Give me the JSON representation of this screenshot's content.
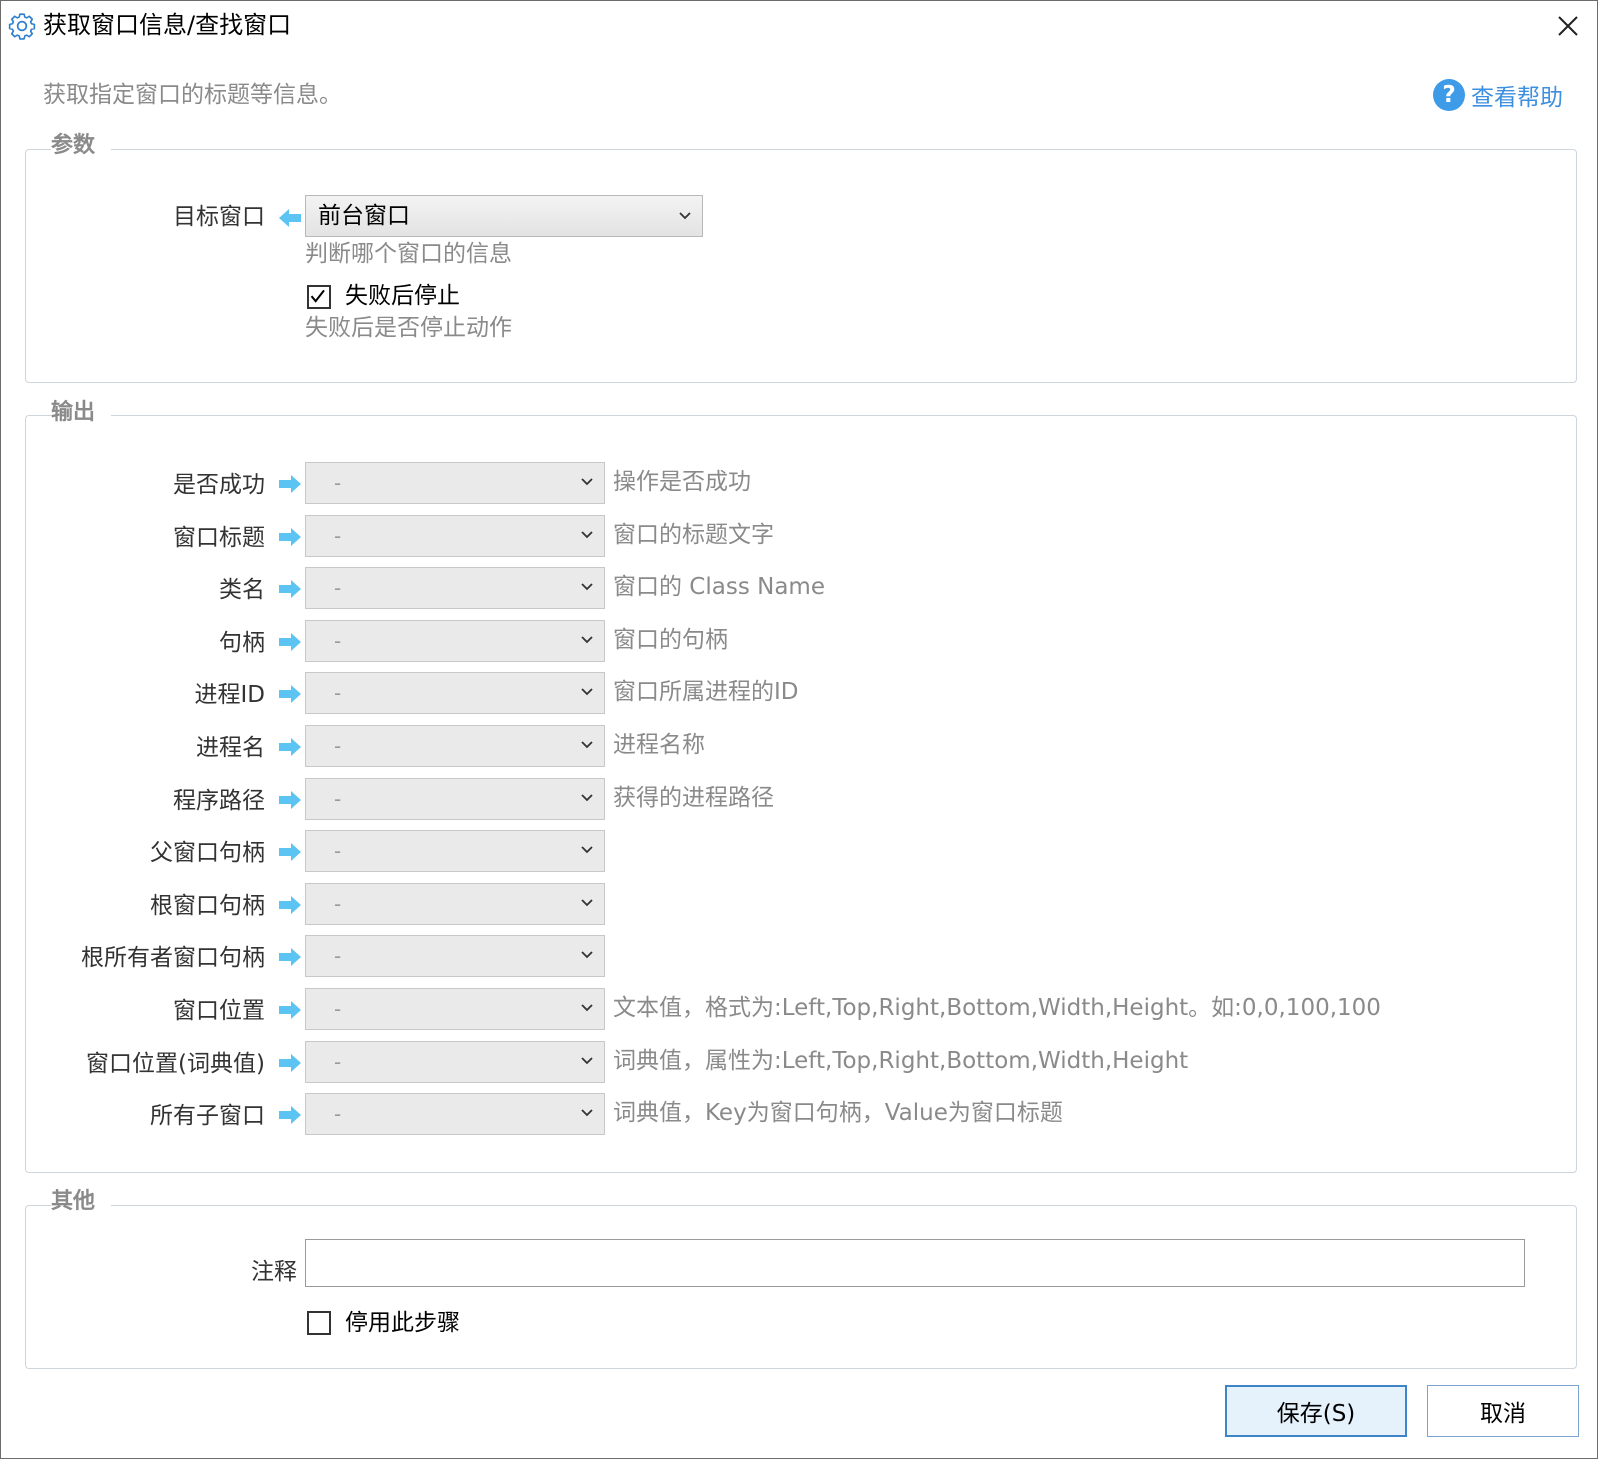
{
  "window": {
    "title": "获取窗口信息/查找窗口"
  },
  "description": "获取指定窗口的标题等信息。",
  "help": {
    "label": "查看帮助",
    "icon": "question-icon"
  },
  "params": {
    "group_title": "参数",
    "target": {
      "label": "目标窗口",
      "value": "前台窗口",
      "hint": "判断哪个窗口的信息"
    },
    "stop_on_fail": {
      "label": "失败后停止",
      "checked": true,
      "hint": "失败后是否停止动作"
    }
  },
  "outputs": {
    "group_title": "输出",
    "rows": [
      {
        "label": "是否成功",
        "value": "-",
        "hint": "操作是否成功"
      },
      {
        "label": "窗口标题",
        "value": "-",
        "hint": "窗口的标题文字"
      },
      {
        "label": "类名",
        "value": "-",
        "hint": "窗口的 Class Name"
      },
      {
        "label": "句柄",
        "value": "-",
        "hint": "窗口的句柄"
      },
      {
        "label": "进程ID",
        "value": "-",
        "hint": "窗口所属进程的ID"
      },
      {
        "label": "进程名",
        "value": "-",
        "hint": "进程名称"
      },
      {
        "label": "程序路径",
        "value": "-",
        "hint": "获得的进程路径"
      },
      {
        "label": "父窗口句柄",
        "value": "-",
        "hint": ""
      },
      {
        "label": "根窗口句柄",
        "value": "-",
        "hint": ""
      },
      {
        "label": "根所有者窗口句柄",
        "value": "-",
        "hint": ""
      },
      {
        "label": "窗口位置",
        "value": "-",
        "hint": "文本值，格式为:Left,Top,Right,Bottom,Width,Height。如:0,0,100,100"
      },
      {
        "label": "窗口位置(词典值)",
        "value": "-",
        "hint": "词典值，属性为:Left,Top,Right,Bottom,Width,Height"
      },
      {
        "label": "所有子窗口",
        "value": "-",
        "hint": "词典值，Key为窗口句柄，Value为窗口标题"
      }
    ]
  },
  "other": {
    "group_title": "其他",
    "comment": {
      "label": "注释",
      "value": "",
      "placeholder": ""
    },
    "disable_step": {
      "label": "停用此步骤",
      "checked": false
    }
  },
  "buttons": {
    "save": "保存(S)",
    "cancel": "取消"
  },
  "colors": {
    "accent": "#3d9be8",
    "arrow": "#5cc4f2",
    "group_border": "#cdd5de"
  }
}
